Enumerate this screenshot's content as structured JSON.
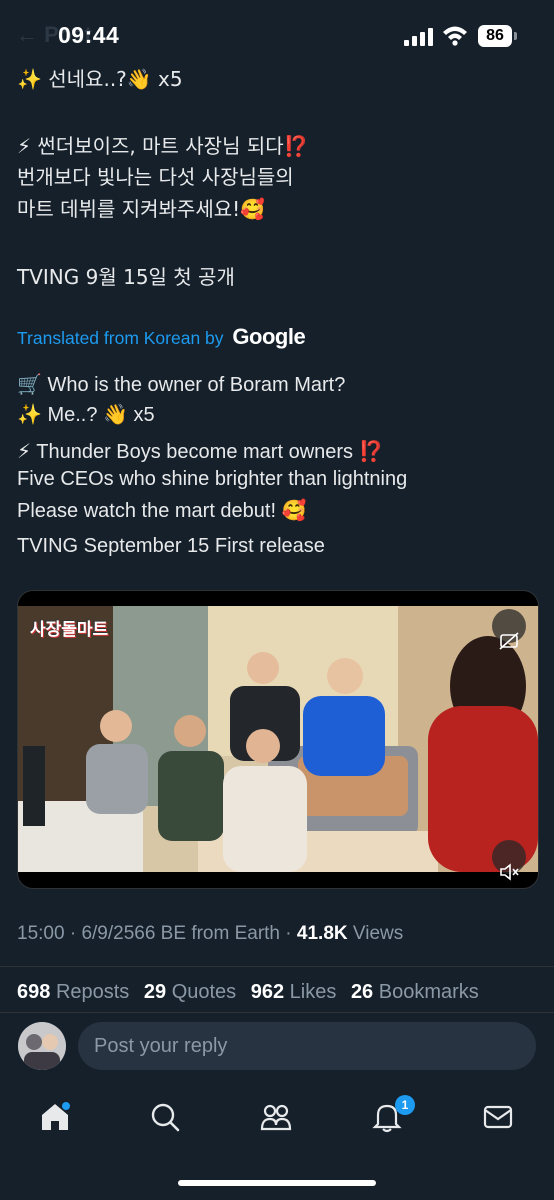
{
  "status_bar": {
    "time": "09:44",
    "battery": "86"
  },
  "header_ghost": "←       Post",
  "tweet": {
    "korean_lines": [
      "✨ 선네요..?👋 x5",
      "⚡ 썬더보이즈, 마트 사장님 되다⁉️",
      "번개보다 빛나는 다섯 사장님들의",
      " 마트 데뷔를 지켜봐주세요!🥰",
      "TVING 9월 15일 첫 공개"
    ],
    "translated_label": "Translated from Korean by",
    "translated_brand": "Google",
    "english_lines": [
      "🛒 Who is the owner of Boram Mart?",
      "✨ Me..? 👋 x5",
      "⚡ Thunder Boys become mart owners ⁉️",
      "Five CEOs who shine brighter than lightning",
      "Please watch the mart debut! 🥰",
      "TVING September 15 First release"
    ]
  },
  "video": {
    "overlay_title": "사장돌마트"
  },
  "meta": {
    "time": "15:00",
    "date": "6/9/2566 BE",
    "source": "from Earth",
    "views_count": "41.8K",
    "views_label": "Views"
  },
  "stats": [
    {
      "count": "698",
      "label": "Reposts"
    },
    {
      "count": "29",
      "label": "Quotes"
    },
    {
      "count": "962",
      "label": "Likes"
    },
    {
      "count": "26",
      "label": "Bookmarks"
    }
  ],
  "reply": {
    "placeholder": "Post your reply"
  },
  "nav": {
    "items": [
      "home-icon",
      "search-icon",
      "communities-icon",
      "notifications-icon",
      "messages-icon"
    ],
    "notification_badge": "1"
  },
  "colors": {
    "background": "#15202b",
    "accent": "#1d9bf0",
    "muted": "#8b98a5"
  }
}
